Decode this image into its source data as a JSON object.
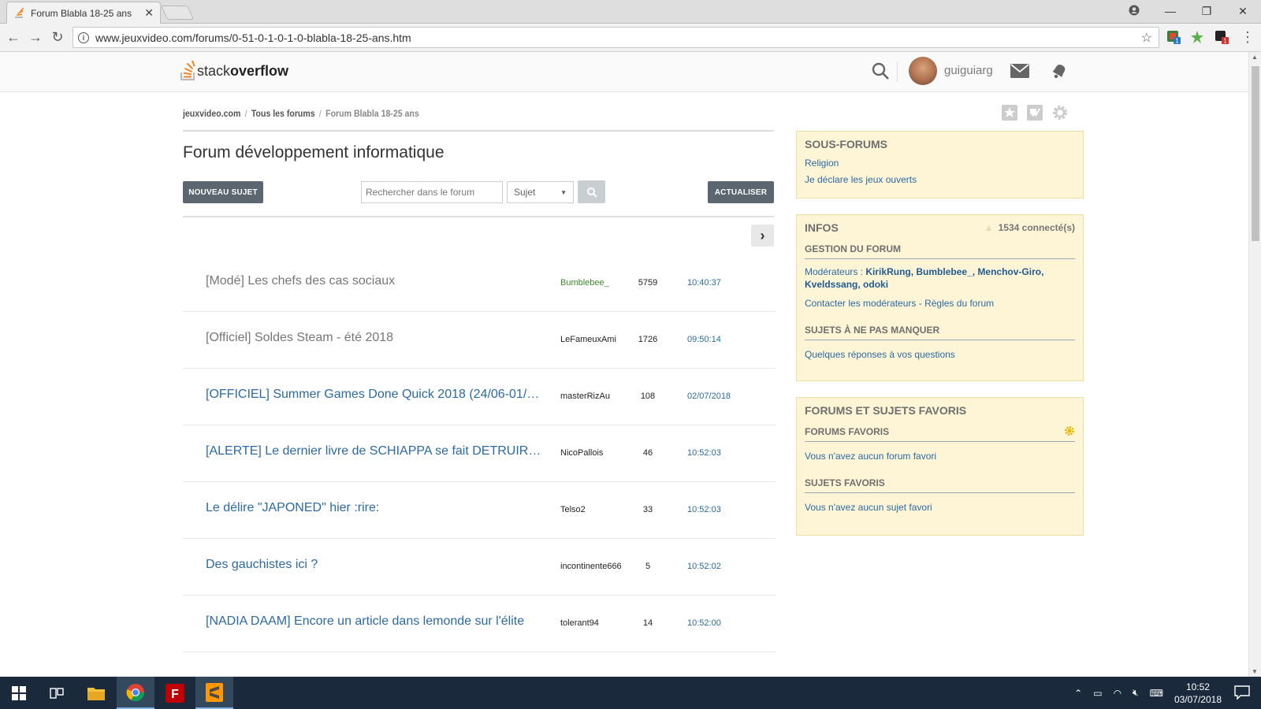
{
  "browser": {
    "tab_title": "Forum Blabla 18-25 ans",
    "url": "www.jeuxvideo.com/forums/0-51-0-1-0-1-0-blabla-18-25-ans.htm",
    "ext_badge_1": "1",
    "ext_badge_2": "1"
  },
  "header": {
    "logo_stack": "stack",
    "logo_overflow": "overflow",
    "username": "guiguiarg"
  },
  "breadcrumb": [
    "jeuxvideo.com",
    "Tous les forums",
    "Forum Blabla 18-25 ans"
  ],
  "breadcrumb_sep": "/",
  "page_title": "Forum développement informatique",
  "controls": {
    "new_topic": "NOUVEAU SUJET",
    "search_placeholder": "Rechercher dans le forum",
    "search_type": "Sujet",
    "refresh": "ACTUALISER"
  },
  "topics": [
    {
      "title": "[Modé] Les chefs des cas sociaux",
      "author": "Bumblebee_",
      "replies": "5759",
      "last": "10:40:37",
      "read": true,
      "mod": true
    },
    {
      "title": "[Officiel] Soldes Steam - été 2018",
      "author": "LeFameuxAmi",
      "replies": "1726",
      "last": "09:50:14",
      "read": true,
      "mod": false
    },
    {
      "title": "[OFFICIEL] Summer Games Done Quick 2018 (24/06-01/…",
      "author": "masterRizAu",
      "replies": "108",
      "last": "02/07/2018",
      "read": false,
      "mod": false
    },
    {
      "title": "[ALERTE] Le dernier livre de SCHIAPPA se fait DETRUIR…",
      "author": "NicoPallois",
      "replies": "46",
      "last": "10:52:03",
      "read": false,
      "mod": false
    },
    {
      "title": "Le délire \"JAPONED\" hier :rire:",
      "author": "Telso2",
      "replies": "33",
      "last": "10:52:03",
      "read": false,
      "mod": false
    },
    {
      "title": "Des gauchistes ici ?",
      "author": "incontinente666",
      "replies": "5",
      "last": "10:52:02",
      "read": false,
      "mod": false
    },
    {
      "title": "[NADIA DAAM] Encore un article dans lemonde sur l'élite",
      "author": "tolerant94",
      "replies": "14",
      "last": "10:52:00",
      "read": false,
      "mod": false
    }
  ],
  "sidebar": {
    "subforums_title": "SOUS-FORUMS",
    "subforums": [
      "Religion",
      "Je déclare les jeux ouverts"
    ],
    "infos_title": "INFOS",
    "connected": "1534 connecté(s)",
    "gestion_title": "GESTION DU FORUM",
    "moderators_label": "Modérateurs :",
    "moderators": "KirikRung, Bumblebee_, Menchov-Giro, Kveldssang, odoki",
    "contact_mods": "Contacter les modérateurs",
    "rules_sep": " - ",
    "rules": "Règles du forum",
    "must_see_title": "SUJETS À NE PAS MANQUER",
    "must_see_link": "Quelques réponses à vos questions",
    "fav_title": "FORUMS ET SUJETS FAVORIS",
    "fav_forums_title": "FORUMS FAVORIS",
    "fav_forums_empty": "Vous n'avez aucun forum favori",
    "fav_topics_title": "SUJETS FAVORIS",
    "fav_topics_empty": "Vous n'avez aucun sujet favori"
  },
  "taskbar": {
    "time": "10:52",
    "date": "03/07/2018"
  },
  "colors": {
    "link": "#2b6aa5",
    "panel_bg": "#fdf5d6",
    "button_dark": "#5b6670",
    "taskbar": "#1a2a3c"
  }
}
